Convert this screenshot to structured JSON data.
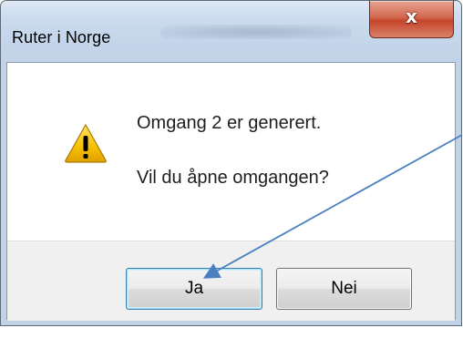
{
  "dialog": {
    "title": "Ruter i Norge",
    "close_glyph": "x",
    "icon": "warning-icon",
    "message_line1": "Omgang 2 er generert.",
    "message_line2": "Vil du åpne omgangen?",
    "buttons": {
      "yes_label": "Ja",
      "no_label": "Nei"
    }
  },
  "annotation": {
    "type": "arrow",
    "color": "#4a7fc1",
    "points_to": "yes-button"
  },
  "colors": {
    "titlebar": "#c2d3e8",
    "close_button": "#c4452a",
    "button_area": "#f0f0f0",
    "warning_fill": "#f6c000",
    "default_button_border": "#3c7fb1"
  }
}
